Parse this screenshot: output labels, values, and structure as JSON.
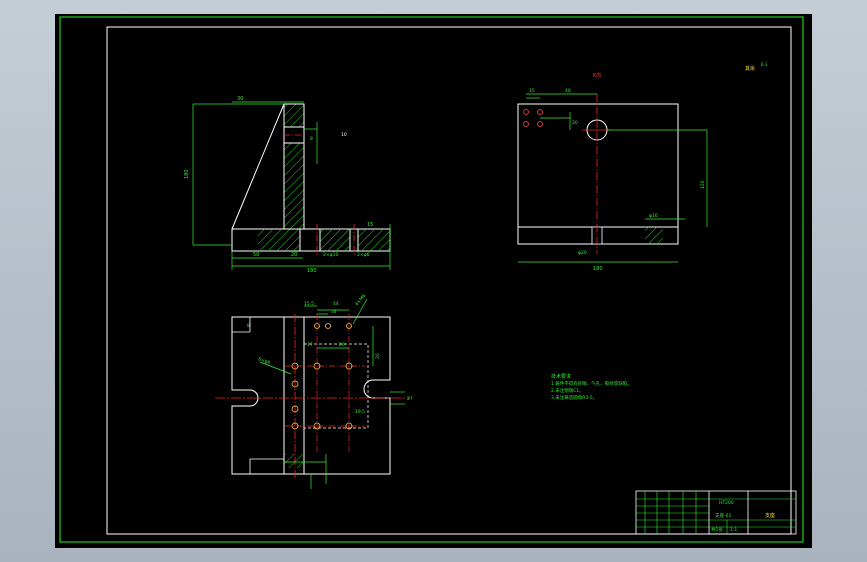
{
  "viewport": {
    "background": "#000000",
    "colors": {
      "outline": "#ffffff",
      "frame": "#22cc22",
      "dimension": "#33ee33",
      "centerline": "#ff2222",
      "hatch": "#22cc22"
    }
  },
  "labels": {
    "top_view_title": "K向",
    "roughness_note": "其余",
    "roughness_symbol": "6.3",
    "front_top_dim": "30",
    "front_height_dim": "180",
    "front_bottom_dims": [
      "50",
      "20",
      "2×φ10",
      "2×φ6"
    ],
    "front_total_dim": "180",
    "front_small_dims": [
      "15",
      "8",
      "10"
    ],
    "top_view_dims": [
      "15",
      "40",
      "20",
      "120",
      "φ16",
      "φ20"
    ],
    "top_view_width": "180",
    "plan_dims": [
      "15.5",
      "44",
      "34",
      "4×M6",
      "17",
      "26",
      "20",
      "19.5",
      "27",
      "8",
      "6×φ8"
    ],
    "tech_req_title": "技术要求",
    "tech_req_lines": [
      "1.铸件不得有砂眼、气孔、裂纹等缺陷。",
      "2.未注倒角C1。",
      "3.未注铸造圆角R3-5。"
    ],
    "title_block": {
      "part_name": "支座",
      "material": "HT200",
      "drawing_no": "支座-01",
      "scale": "1:1",
      "sheet": "共1张"
    }
  }
}
